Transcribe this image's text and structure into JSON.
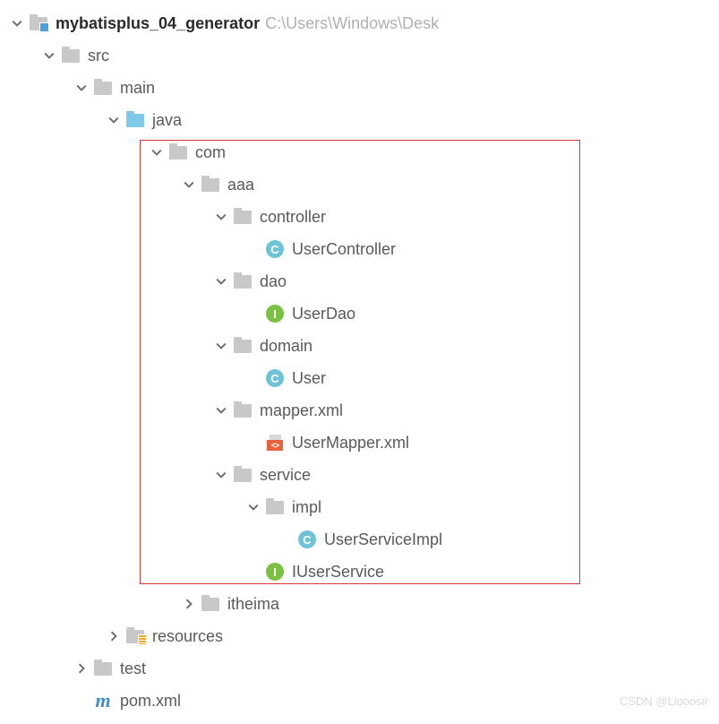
{
  "root": {
    "name": "mybatisplus_04_generator",
    "path_hint": "C:\\Users\\Windows\\Desk"
  },
  "nodes": {
    "src": "src",
    "main": "main",
    "java": "java",
    "com": "com",
    "aaa": "aaa",
    "controller": "controller",
    "userController": "UserController",
    "dao": "dao",
    "userDao": "UserDao",
    "domain": "domain",
    "user": "User",
    "mapperxml": "mapper.xml",
    "userMapperXml": "UserMapper.xml",
    "service": "service",
    "impl": "impl",
    "userServiceImpl": "UserServiceImpl",
    "iUserService": "IUserService",
    "itheima": "itheima",
    "resources": "resources",
    "test": "test",
    "pom": "pom.xml"
  },
  "badges": {
    "class": "C",
    "interface": "I"
  },
  "watermark": "CSDN @Liooosir"
}
